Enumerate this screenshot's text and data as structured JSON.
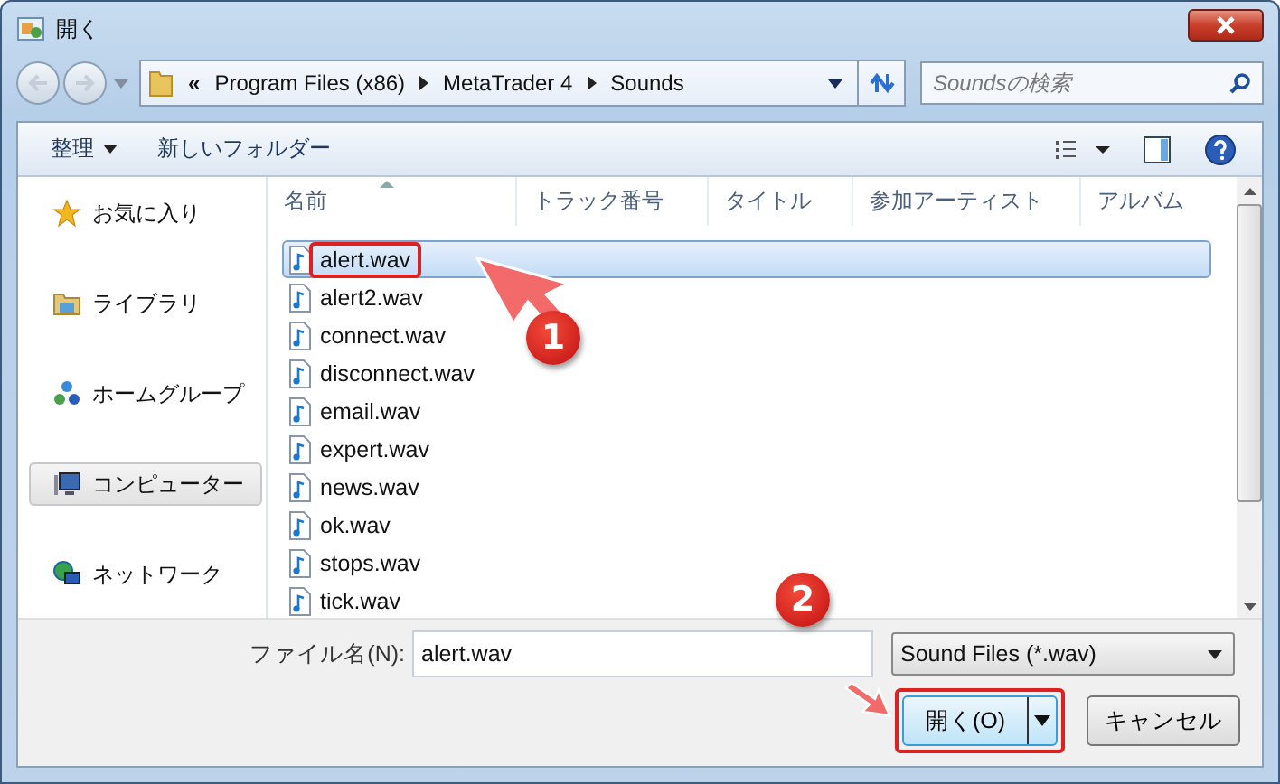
{
  "window": {
    "title": "開く"
  },
  "address": {
    "chevron": "«",
    "crumbs": [
      "Program Files (x86)",
      "MetaTrader 4",
      "Sounds"
    ]
  },
  "search": {
    "placeholder": "Soundsの検索"
  },
  "toolbar": {
    "organize": "整理",
    "new_folder": "新しいフォルダー"
  },
  "sidebar": {
    "items": [
      {
        "label": "お気に入り",
        "kind": "favorites",
        "selected": false
      },
      {
        "label": "ライブラリ",
        "kind": "libraries",
        "selected": false
      },
      {
        "label": "ホームグループ",
        "kind": "homegroup",
        "selected": false
      },
      {
        "label": "コンピューター",
        "kind": "computer",
        "selected": true
      },
      {
        "label": "ネットワーク",
        "kind": "network",
        "selected": false
      }
    ]
  },
  "table": {
    "columns": [
      {
        "label": "名前",
        "sorted": true
      },
      {
        "label": "トラック番号",
        "sorted": false
      },
      {
        "label": "タイトル",
        "sorted": false
      },
      {
        "label": "参加アーティスト",
        "sorted": false
      },
      {
        "label": "アルバム",
        "sorted": false
      }
    ],
    "rows": [
      {
        "name": "alert.wav",
        "selected": true,
        "highlighted": true
      },
      {
        "name": "alert2.wav",
        "selected": false,
        "highlighted": false
      },
      {
        "name": "connect.wav",
        "selected": false,
        "highlighted": false
      },
      {
        "name": "disconnect.wav",
        "selected": false,
        "highlighted": false
      },
      {
        "name": "email.wav",
        "selected": false,
        "highlighted": false
      },
      {
        "name": "expert.wav",
        "selected": false,
        "highlighted": false
      },
      {
        "name": "news.wav",
        "selected": false,
        "highlighted": false
      },
      {
        "name": "ok.wav",
        "selected": false,
        "highlighted": false
      },
      {
        "name": "stops.wav",
        "selected": false,
        "highlighted": false
      },
      {
        "name": "tick.wav",
        "selected": false,
        "highlighted": false
      }
    ]
  },
  "bottom": {
    "filename_label": "ファイル名(N):",
    "filename_value": "alert.wav",
    "filter": "Sound Files (*.wav)",
    "open_button": "開く(O)",
    "cancel_button": "キャンセル",
    "open_highlighted": true
  },
  "annotations": [
    {
      "label": "1"
    },
    {
      "label": "2"
    }
  ]
}
